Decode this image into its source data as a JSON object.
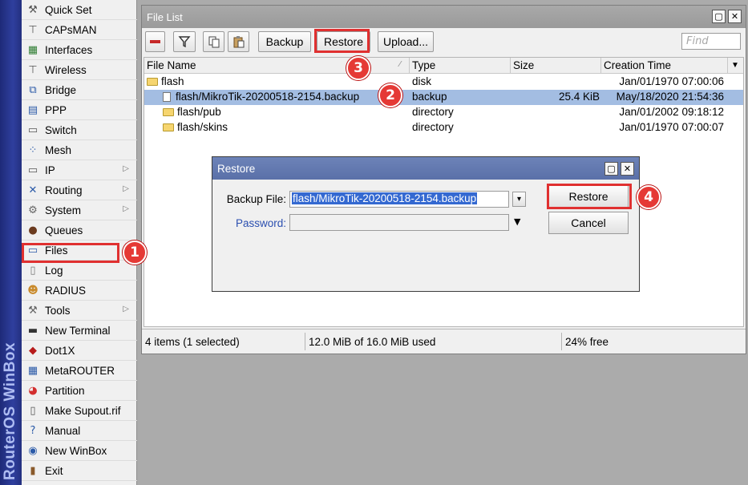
{
  "brand": {
    "text": "RouterOS WinBox"
  },
  "sidebar": {
    "items": [
      {
        "label": "Quick Set",
        "icon": "quick-set-icon",
        "glyph": "⚒",
        "color": "#555555"
      },
      {
        "label": "CAPsMAN",
        "icon": "antenna-icon",
        "glyph": "⊤",
        "color": "#555555"
      },
      {
        "label": "Interfaces",
        "icon": "interfaces-icon",
        "glyph": "▦",
        "color": "#2e7d32"
      },
      {
        "label": "Wireless",
        "icon": "wireless-icon",
        "glyph": "⊤",
        "color": "#555555"
      },
      {
        "label": "Bridge",
        "icon": "bridge-icon",
        "glyph": "⧉",
        "color": "#2b5aa8"
      },
      {
        "label": "PPP",
        "icon": "ppp-icon",
        "glyph": "▤",
        "color": "#2b5aa8"
      },
      {
        "label": "Switch",
        "icon": "switch-icon",
        "glyph": "▭",
        "color": "#555555"
      },
      {
        "label": "Mesh",
        "icon": "mesh-icon",
        "glyph": "⁘",
        "color": "#2b5aa8"
      },
      {
        "label": "IP",
        "icon": "ip-icon",
        "glyph": "▭",
        "color": "#555555",
        "submenu": true
      },
      {
        "label": "Routing",
        "icon": "routing-icon",
        "glyph": "✕",
        "color": "#2b5aa8",
        "submenu": true
      },
      {
        "label": "System",
        "icon": "system-gear-icon",
        "glyph": "⚙",
        "color": "#666666",
        "submenu": true
      },
      {
        "label": "Queues",
        "icon": "queues-icon",
        "glyph": "●",
        "color": "#6b3b1f"
      },
      {
        "label": "Files",
        "icon": "files-folder-icon",
        "glyph": "▭",
        "color": "#2b5aa8"
      },
      {
        "label": "Log",
        "icon": "log-icon",
        "glyph": "▯",
        "color": "#777777"
      },
      {
        "label": "RADIUS",
        "icon": "radius-icon",
        "glyph": "☻",
        "color": "#c98a2b"
      },
      {
        "label": "Tools",
        "icon": "tools-icon",
        "glyph": "⚒",
        "color": "#666666",
        "submenu": true
      },
      {
        "label": "New Terminal",
        "icon": "terminal-icon",
        "glyph": "▬",
        "color": "#333333"
      },
      {
        "label": "Dot1X",
        "icon": "dot1x-icon",
        "glyph": "◆",
        "color": "#b71c1c"
      },
      {
        "label": "MetaROUTER",
        "icon": "metarouter-icon",
        "glyph": "▦",
        "color": "#2b5aa8"
      },
      {
        "label": "Partition",
        "icon": "partition-pie-icon",
        "glyph": "◕",
        "color": "#d32f2f"
      },
      {
        "label": "Make Supout.rif",
        "icon": "supout-file-icon",
        "glyph": "▯",
        "color": "#555555"
      },
      {
        "label": "Manual",
        "icon": "manual-help-icon",
        "glyph": "?",
        "color": "#2b5aa8"
      },
      {
        "label": "New WinBox",
        "icon": "winbox-globe-icon",
        "glyph": "◉",
        "color": "#2b5aa8"
      },
      {
        "label": "Exit",
        "icon": "exit-door-icon",
        "glyph": "▮",
        "color": "#8a5a2b"
      }
    ]
  },
  "file_list": {
    "title": "File List",
    "toolbar": {
      "remove_icon": "minus-icon",
      "filter_icon": "filter-icon",
      "copy_icon": "copy-icon",
      "paste_icon": "paste-icon",
      "backup_label": "Backup",
      "restore_label": "Restore",
      "upload_label": "Upload...",
      "find_placeholder": "Find"
    },
    "columns": [
      "File Name",
      "Type",
      "Size",
      "Creation Time"
    ],
    "rows": [
      {
        "name": "flash",
        "type": "disk",
        "size": "",
        "time": "Jan/01/1970 07:00:06",
        "kind": "folder",
        "indent": 0
      },
      {
        "name": "flash/MikroTik-20200518-2154.backup",
        "type": "backup",
        "size": "25.4 KiB",
        "time": "May/18/2020 21:54:36",
        "kind": "file",
        "indent": 1,
        "selected": true
      },
      {
        "name": "flash/pub",
        "type": "directory",
        "size": "",
        "time": "Jan/01/2002 09:18:12",
        "kind": "folder",
        "indent": 1
      },
      {
        "name": "flash/skins",
        "type": "directory",
        "size": "",
        "time": "Jan/01/1970 07:00:07",
        "kind": "folder",
        "indent": 1
      }
    ],
    "status": {
      "items": "4 items (1 selected)",
      "usage": "12.0 MiB of 16.0 MiB used",
      "free": "24% free"
    }
  },
  "restore_dialog": {
    "title": "Restore",
    "backup_file_label": "Backup File:",
    "backup_file_value": "flash/MikroTik-20200518-2154.backup",
    "password_label": "Password:",
    "password_value": "",
    "restore_button": "Restore",
    "cancel_button": "Cancel"
  },
  "steps": [
    "1",
    "2",
    "3",
    "4"
  ],
  "colors": {
    "highlight": "#e03030",
    "badge": "#e53935",
    "selection": "#a3bde2",
    "dialog_title": "#5a70a8"
  }
}
